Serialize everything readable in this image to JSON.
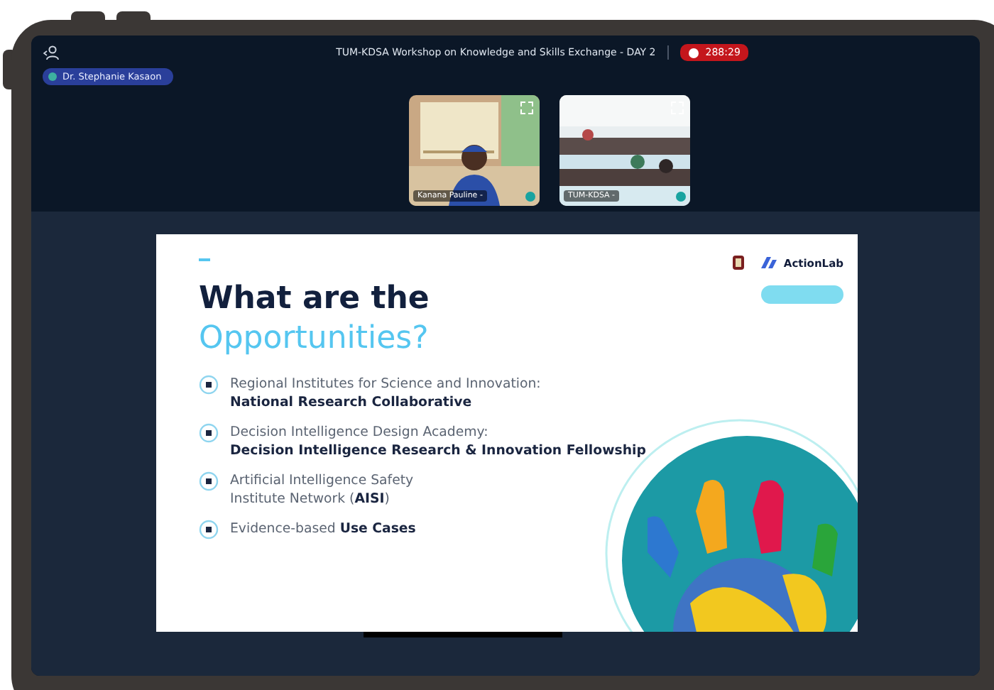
{
  "meeting": {
    "title": "TUM-KDSA Workshop on Knowledge and Skills Exchange - DAY 2",
    "recording_time": "288:29",
    "host": "Dr. Stephanie Kasaon"
  },
  "video_tiles": [
    {
      "name": "Kanana Pauline -"
    },
    {
      "name": "TUM-KDSA -"
    }
  ],
  "slide": {
    "brand": "ActionLab",
    "title": "What are the",
    "title_highlight": "Opportunities?",
    "items": [
      {
        "lines": [
          "Regional Institutes for Science and Innovation:",
          "**National Research Collaborative**"
        ]
      },
      {
        "lines": [
          "Decision Intelligence Design Academy:",
          "**Decision Intelligence Research & Innovation Fellowship**"
        ]
      },
      {
        "lines": [
          "Artificial Intelligence Safety",
          "Institute Network (**AISI**)"
        ]
      },
      {
        "lines": [
          "Evidence-based **Use Cases**"
        ]
      }
    ]
  }
}
